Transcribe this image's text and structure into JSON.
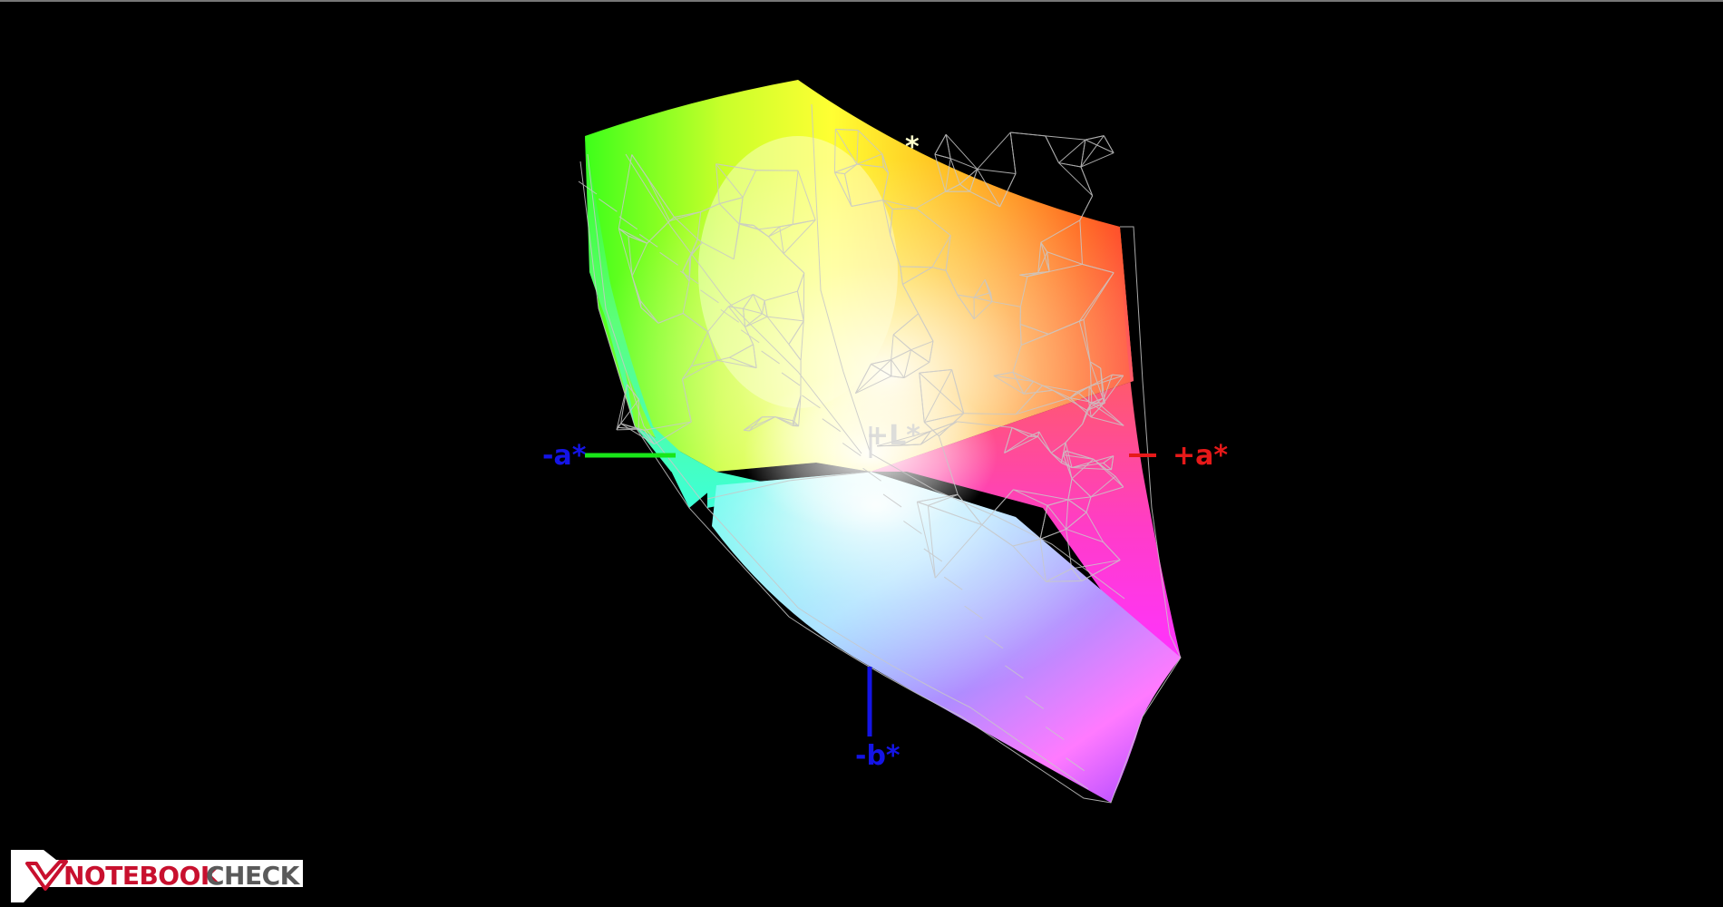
{
  "diagram": {
    "axes": {
      "neg_a": "-a*",
      "pos_a": "+a*",
      "neg_b": "-b*",
      "pos_l": "+L*",
      "top_marker": "*"
    },
    "colors": {
      "background": "#000000",
      "neg_a_axis": "#19e619",
      "pos_a_axis": "#e61919",
      "b_axis": "#1414e6",
      "l_axis": "#cccccc",
      "mesh": "#c8c8c8"
    }
  },
  "logo": {
    "brand_notebook": "NOTEBOOK",
    "brand_check": "CHECK",
    "colors": {
      "notebook": "#c8102e",
      "check": "#5a5a5a"
    }
  }
}
